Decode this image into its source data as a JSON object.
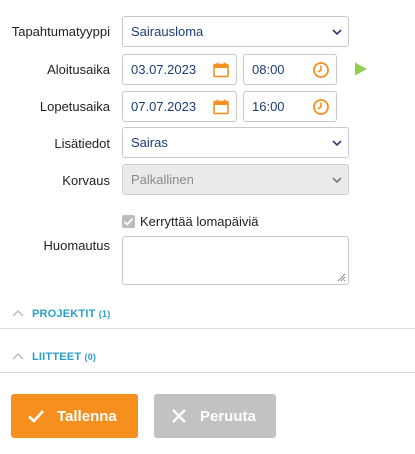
{
  "form": {
    "event_type": {
      "label": "Tapahtumatyyppi",
      "value": "Sairausloma"
    },
    "start": {
      "label": "Aloitusaika",
      "date": "03.07.2023",
      "time": "08:00"
    },
    "end": {
      "label": "Lopetusaika",
      "date": "07.07.2023",
      "time": "16:00"
    },
    "details": {
      "label": "Lisätiedot",
      "value": "Sairas"
    },
    "compensation": {
      "label": "Korvaus",
      "value": "Palkallinen"
    },
    "accrue": {
      "label": "Kerryttää lomapäiviä",
      "checked": true
    },
    "note": {
      "label": "Huomautus",
      "value": ""
    }
  },
  "sections": {
    "projects": {
      "title": "PROJEKTIT",
      "count": "(1)"
    },
    "attachments": {
      "title": "LIITTEET",
      "count": "(0)"
    }
  },
  "buttons": {
    "save": "Tallenna",
    "cancel": "Peruuta"
  },
  "colors": {
    "accent_orange": "#f5901e",
    "link_blue": "#2a9fc9",
    "play_green": "#8fd14f",
    "disabled_button": "#c2c2c2"
  }
}
